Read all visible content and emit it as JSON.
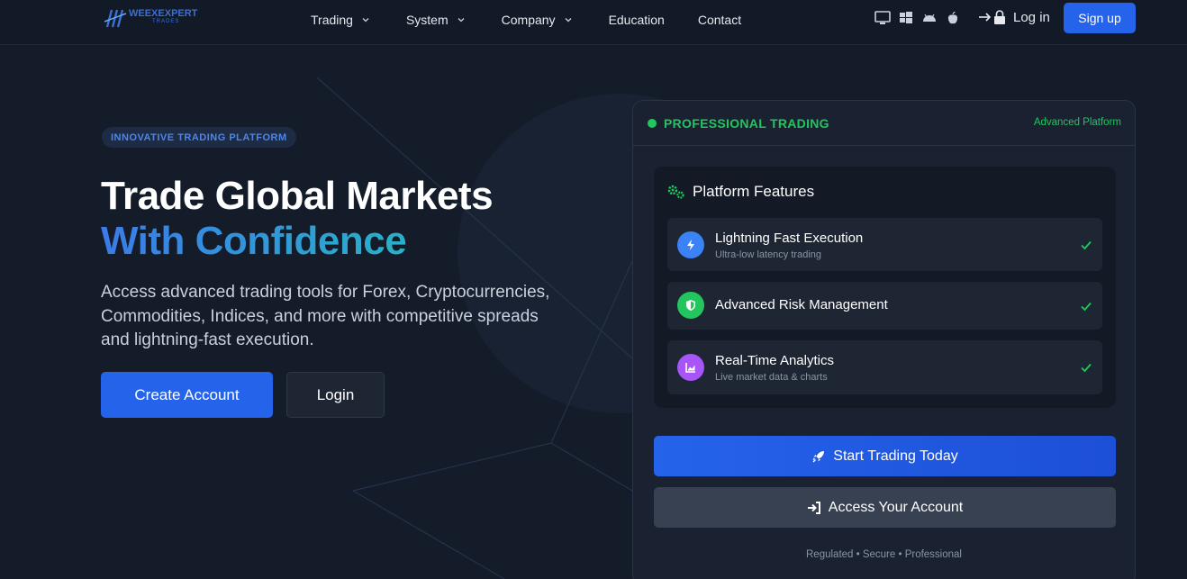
{
  "header": {
    "logo": {
      "line1": "WEEXEXPERT",
      "line2": "TRADES"
    },
    "nav": [
      {
        "label": "Trading",
        "dropdown": true
      },
      {
        "label": "System",
        "dropdown": true
      },
      {
        "label": "Company",
        "dropdown": true
      },
      {
        "label": "Education",
        "dropdown": false
      },
      {
        "label": "Contact",
        "dropdown": false
      }
    ],
    "platform_icons": [
      "desktop-icon",
      "windows-icon",
      "android-icon",
      "apple-icon"
    ],
    "login_label": "Log in",
    "signup_label": "Sign up"
  },
  "hero": {
    "badge": "INNOVATIVE TRADING PLATFORM",
    "title_line1": "Trade Global Markets",
    "title_line2": "With Confidence",
    "lead": "Access advanced trading tools for Forex, Cryptocurrencies, Commodities, Indices, and more with competitive spreads and lightning-fast execution.",
    "create_account": "Create Account",
    "login": "Login"
  },
  "card": {
    "title": "PROFESSIONAL TRADING",
    "subtitle": "Advanced Platform",
    "features_heading": "Platform Features",
    "features": [
      {
        "title": "Lightning Fast Execution",
        "desc": "Ultra-low latency trading",
        "icon": "bolt-icon",
        "color": "#3b82f6"
      },
      {
        "title": "Advanced Risk Management",
        "desc": "",
        "icon": "shield-icon",
        "color": "#22c55e"
      },
      {
        "title": "Real-Time Analytics",
        "desc": "Live market data & charts",
        "icon": "chart-icon",
        "color": "#a855f7"
      }
    ],
    "start_button": "Start Trading Today",
    "access_button": "Access Your Account",
    "footer": "Regulated • Secure • Professional"
  },
  "colors": {
    "accent": "#2563eb",
    "success": "#22c55e",
    "background": "#141b29"
  }
}
